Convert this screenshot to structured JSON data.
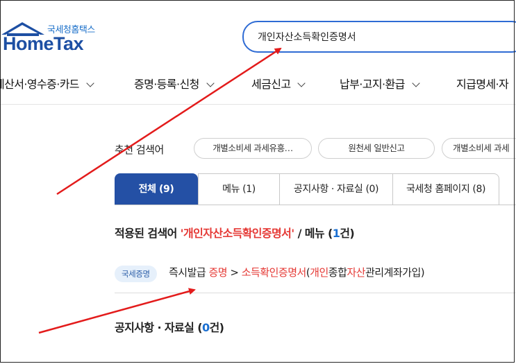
{
  "logo": {
    "subtitle": "국세청홈택스",
    "name": "HomeTax"
  },
  "search": {
    "value": "개인자산소득확인증명서"
  },
  "nav": {
    "items": [
      {
        "label": "계산서·영수증·카드"
      },
      {
        "label": "증명·등록·신청"
      },
      {
        "label": "세금신고"
      },
      {
        "label": "납부·고지·환급"
      },
      {
        "label": "지급명세·자"
      }
    ]
  },
  "recommended": {
    "label": "추천 검색어",
    "chips": [
      "개별소비세 과세유흥…",
      "원천세 일반신고",
      "개별소비세 과세"
    ]
  },
  "tabs": [
    {
      "label": "전체 (9)",
      "active": true
    },
    {
      "label": "메뉴 (1)"
    },
    {
      "label": "공지사항 · 자료실 (0)"
    },
    {
      "label": "국세청 홈페이지 (8)"
    }
  ],
  "result": {
    "prefix": "적용된 검색어 ",
    "query": "'개인자산소득확인증명서'",
    "section": " / 메뉴 (",
    "count": "1",
    "suffix": "건)"
  },
  "result_item": {
    "badge": "국세증명",
    "parts": [
      {
        "text": "즉시발급 ",
        "hl": false
      },
      {
        "text": "증명",
        "hl": true
      },
      {
        "text": " > ",
        "hl": false
      },
      {
        "text": "소득확인증명서",
        "hl": true
      },
      {
        "text": "(",
        "hl": false
      },
      {
        "text": "개인",
        "hl": true
      },
      {
        "text": "종합",
        "hl": false
      },
      {
        "text": "자산",
        "hl": true
      },
      {
        "text": "관리계좌가입)",
        "hl": false
      }
    ]
  },
  "notice": {
    "prefix": "공지사항 · 자료실 (",
    "count": "0",
    "suffix": "건)"
  },
  "colors": {
    "accent": "#2450a5",
    "highlight": "#e53935",
    "annotation_arrow": "#e31b1b"
  }
}
